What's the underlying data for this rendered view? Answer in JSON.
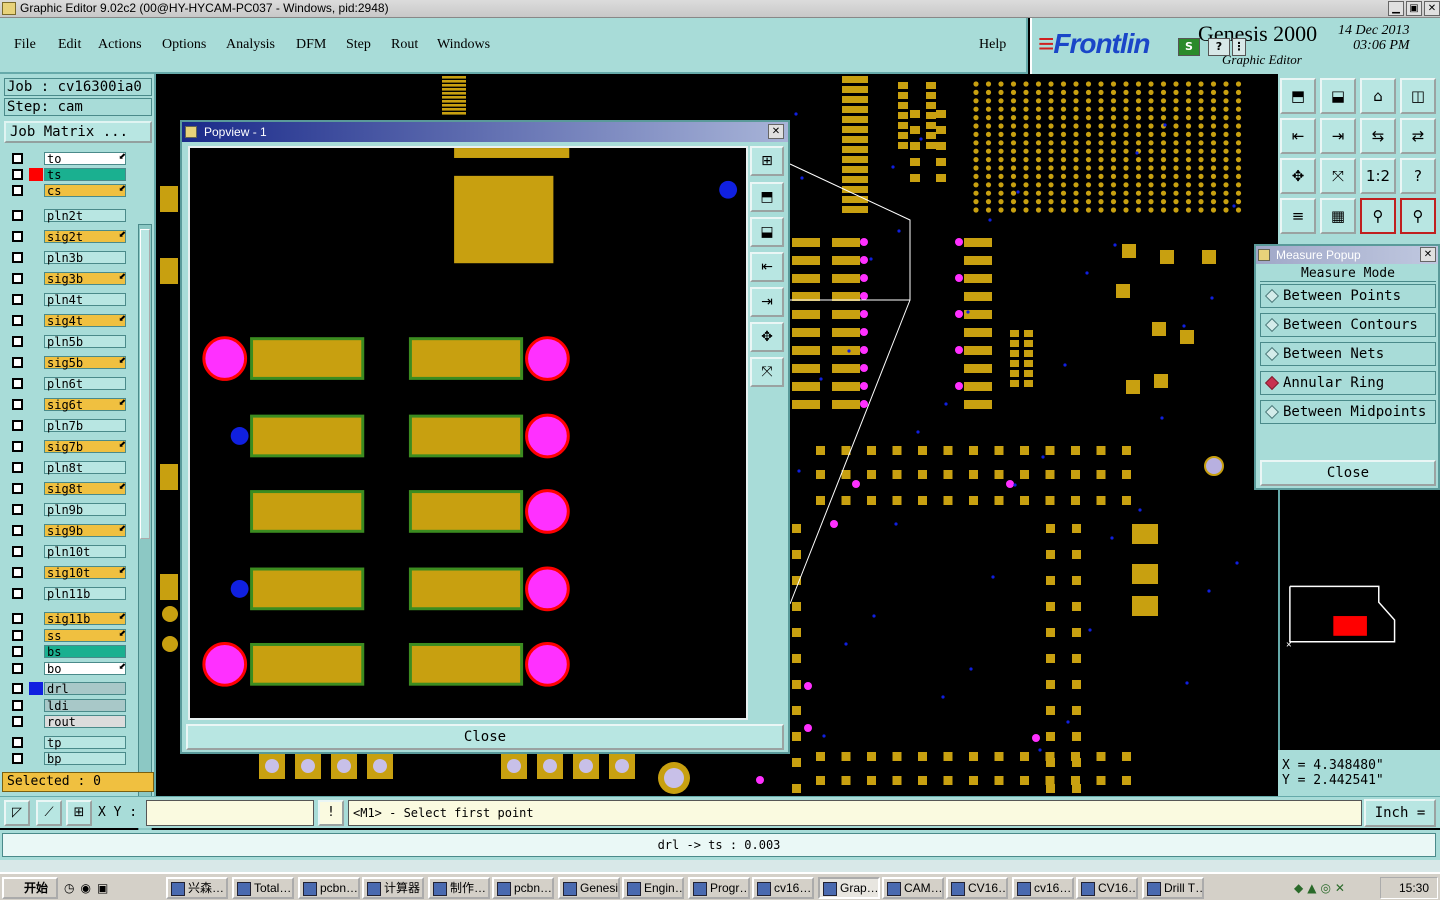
{
  "window": {
    "title": "Graphic Editor 9.02c2 (00@HY-HYCAM-PC037 - Windows, pid:2948)",
    "btn_min": "▁",
    "btn_max": "▣",
    "btn_close": "✕"
  },
  "menu": [
    "File",
    "Edit",
    "Actions",
    "Options",
    "Analysis",
    "DFM",
    "Step",
    "Rout",
    "Windows"
  ],
  "menu_help": "Help",
  "brand": {
    "logo_a": "Frontlin",
    "product": "Genesis 2000",
    "subtitle": "Graphic Editor",
    "date_line1": "14 Dec 2013",
    "date_line2": "03:06 PM",
    "btn_s": "S",
    "btn_q": "?",
    "btn_more": "⋮"
  },
  "job": {
    "job_label": "Job : cv16300ia0",
    "step_label": "Step: cam",
    "matrix_btn": "Job Matrix ..."
  },
  "layers": [
    {
      "name": "to",
      "color": "#ffffff",
      "swatch": "",
      "arrow": true
    },
    {
      "name": "ts",
      "color": "#1ab090",
      "swatch": "#ff0000",
      "arrow": false
    },
    {
      "name": "cs",
      "color": "#f0c040",
      "swatch": "",
      "arrow": true
    },
    {
      "name": "pln2t",
      "color": "#b8e6e2",
      "swatch": "",
      "arrow": false
    },
    {
      "name": "sig2t",
      "color": "#f0c040",
      "swatch": "",
      "arrow": true
    },
    {
      "name": "pln3b",
      "color": "#b8e6e2",
      "swatch": "",
      "arrow": false
    },
    {
      "name": "sig3b",
      "color": "#f0c040",
      "swatch": "",
      "arrow": true
    },
    {
      "name": "pln4t",
      "color": "#b8e6e2",
      "swatch": "",
      "arrow": false
    },
    {
      "name": "sig4t",
      "color": "#f0c040",
      "swatch": "",
      "arrow": true
    },
    {
      "name": "pln5b",
      "color": "#b8e6e2",
      "swatch": "",
      "arrow": false
    },
    {
      "name": "sig5b",
      "color": "#f0c040",
      "swatch": "",
      "arrow": true
    },
    {
      "name": "pln6t",
      "color": "#b8e6e2",
      "swatch": "",
      "arrow": false
    },
    {
      "name": "sig6t",
      "color": "#f0c040",
      "swatch": "",
      "arrow": true
    },
    {
      "name": "pln7b",
      "color": "#b8e6e2",
      "swatch": "",
      "arrow": false
    },
    {
      "name": "sig7b",
      "color": "#f0c040",
      "swatch": "",
      "arrow": true
    },
    {
      "name": "pln8t",
      "color": "#b8e6e2",
      "swatch": "",
      "arrow": false
    },
    {
      "name": "sig8t",
      "color": "#f0c040",
      "swatch": "",
      "arrow": true
    },
    {
      "name": "pln9b",
      "color": "#b8e6e2",
      "swatch": "",
      "arrow": false
    },
    {
      "name": "sig9b",
      "color": "#f0c040",
      "swatch": "",
      "arrow": true
    },
    {
      "name": "pln10t",
      "color": "#b8e6e2",
      "swatch": "",
      "arrow": false
    },
    {
      "name": "sig10t",
      "color": "#f0c040",
      "swatch": "",
      "arrow": true
    },
    {
      "name": "pln11b",
      "color": "#b8e6e2",
      "swatch": "",
      "arrow": false
    },
    {
      "name": "sig11b",
      "color": "#f0c040",
      "swatch": "",
      "arrow": true
    },
    {
      "name": "ss",
      "color": "#f0c040",
      "swatch": "",
      "arrow": true
    },
    {
      "name": "bs",
      "color": "#1ab090",
      "swatch": "",
      "arrow": false
    },
    {
      "name": "bo",
      "color": "#ffffff",
      "swatch": "",
      "arrow": true
    },
    {
      "name": "drl",
      "color": "#a8c8c8",
      "swatch": "#1020e0",
      "arrow": false
    },
    {
      "name": "ldi",
      "color": "#a8c8c8",
      "swatch": "",
      "arrow": false
    },
    {
      "name": "rout",
      "color": "#dcdcdc",
      "swatch": "",
      "arrow": false
    },
    {
      "name": "tp",
      "color": "#b8e6e2",
      "swatch": "",
      "arrow": false
    },
    {
      "name": "bp",
      "color": "#b8e6e2",
      "swatch": "",
      "arrow": false
    }
  ],
  "selected": "Selected : 0",
  "popview": {
    "title": "Popview - 1",
    "close": "Close"
  },
  "measure": {
    "title": "Measure Popup",
    "mode_label": "Measure Mode",
    "options": [
      {
        "label": "Between Points",
        "active": false
      },
      {
        "label": "Between Contours",
        "active": false
      },
      {
        "label": "Between Nets",
        "active": false
      },
      {
        "label": "Annular Ring",
        "active": true
      },
      {
        "label": "Between Midpoints",
        "active": false
      }
    ],
    "close": "Close"
  },
  "right_tools": [
    "⬒",
    "⬓",
    "⌂",
    "◫",
    "⇤",
    "⇥",
    "⇆",
    "⇄",
    "✥",
    "⤧",
    "1:2",
    "?",
    "≡",
    "▦",
    "⚲",
    "⚲"
  ],
  "tool_one_to_two": "1:2",
  "coords": {
    "x": "X = 4.348480\"",
    "y": "Y = 2.442541\""
  },
  "command": {
    "xy_label": "X Y :",
    "xy_value": "",
    "bang": "!",
    "prompt": "<M1> - Select first point",
    "unit": "Inch ="
  },
  "status_msg": "drl -> ts : 0.003",
  "taskbar": {
    "start": "开始",
    "clock": "15:30",
    "tasks": [
      "兴森…",
      "Total…",
      "pcbn…",
      "计算器",
      "制作…",
      "pcbn…",
      "Genesis",
      "Engin…",
      "Progr…",
      "cv16…",
      "Grap…",
      "CAM…",
      "CV16…",
      "cv16…",
      "CV16…",
      "Drill T…"
    ]
  },
  "colors": {
    "panel": "#a8dcd8",
    "pad": "#c8a010",
    "pad_outline": "#3c8c20",
    "hole": "#ff30ff",
    "via": "#1020e0",
    "ring": "#ff0000"
  }
}
